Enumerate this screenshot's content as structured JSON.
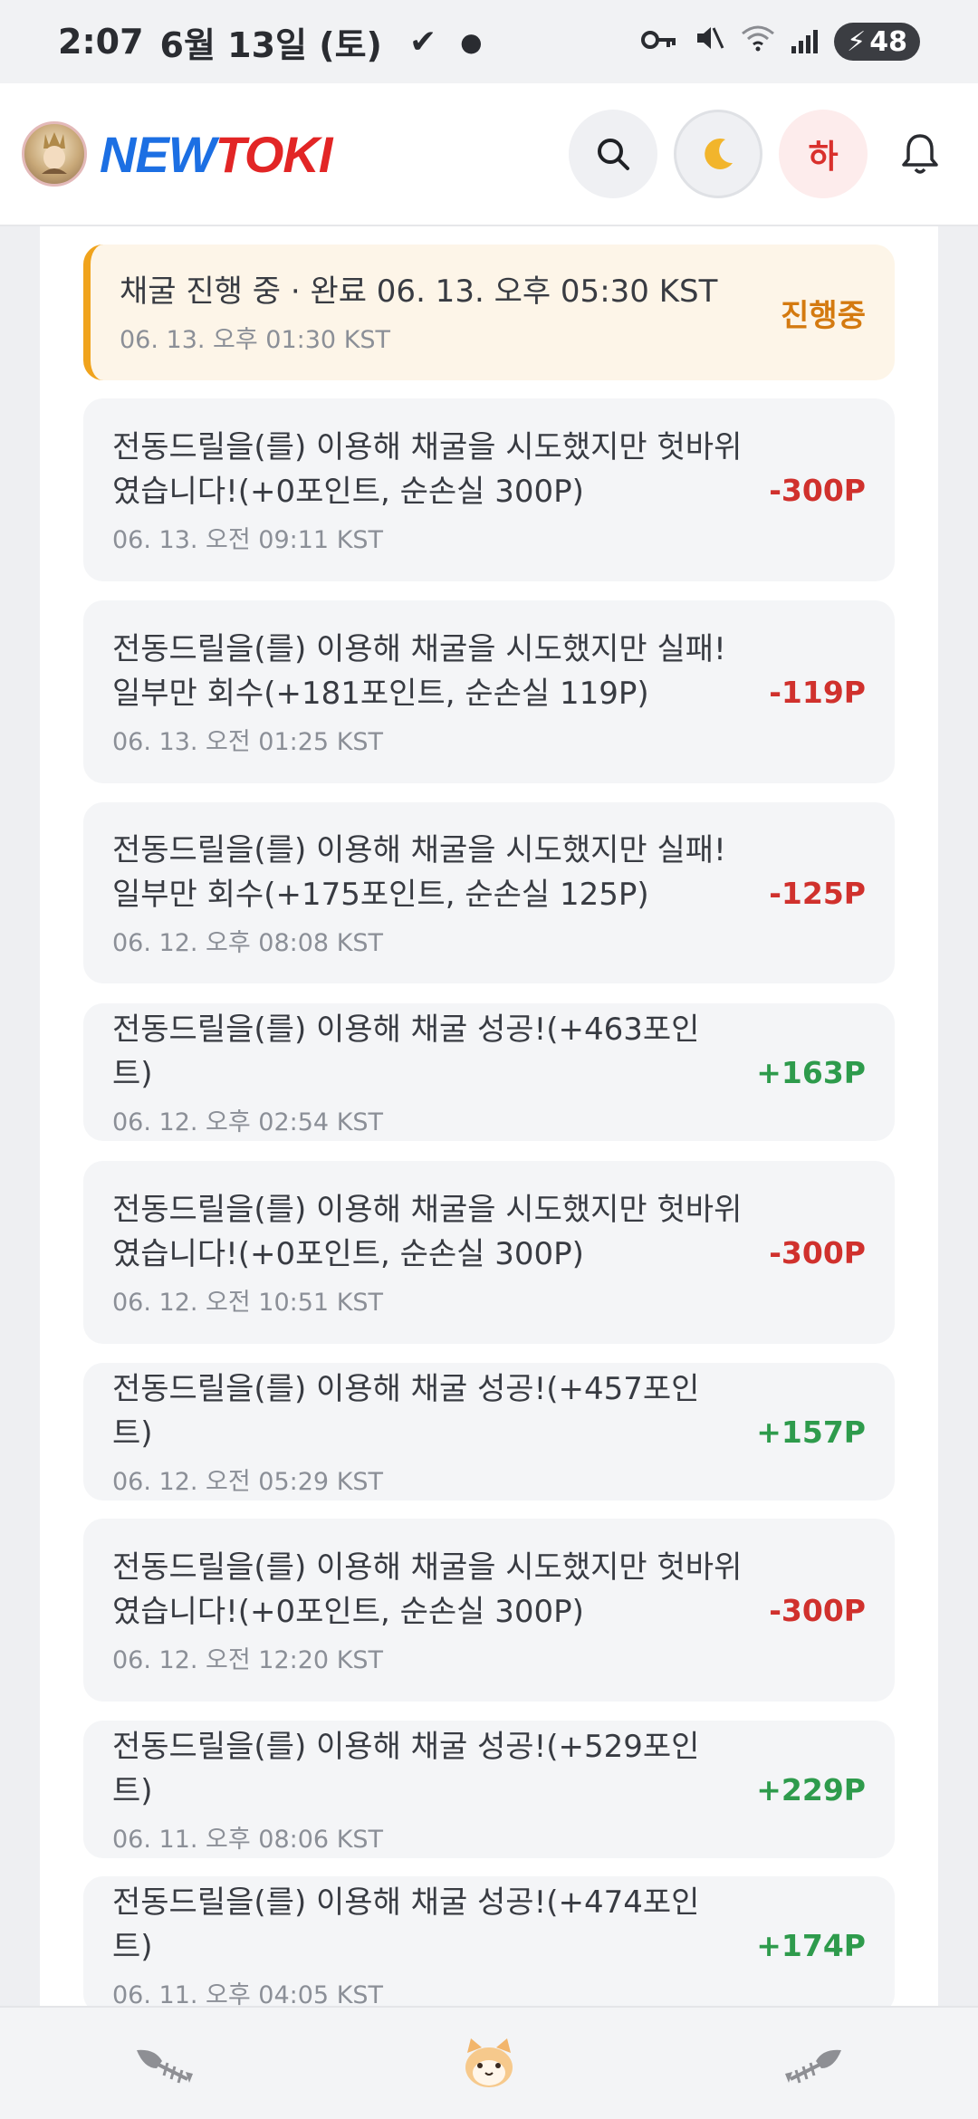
{
  "status_bar": {
    "time": "2:07",
    "date": "6월 13일 (토)",
    "battery": "48"
  },
  "header": {
    "logo_new": "NEW",
    "logo_toki": "TOKI",
    "level_label": "하"
  },
  "log": [
    {
      "desc": "채굴 진행 중 · 완료 06. 13. 오후 05:30 KST",
      "time": "06. 13. 오후 01:30 KST",
      "amount": "진행중",
      "kind": "progress"
    },
    {
      "desc": "전동드릴을(를) 이용해 채굴을 시도했지만 헛바위였습니다!(+0포인트, 순손실 300P)",
      "time": "06. 13. 오전 09:11 KST",
      "amount": "-300P",
      "kind": "neg"
    },
    {
      "desc": "전동드릴을(를) 이용해 채굴을 시도했지만 실패! 일부만 회수(+181포인트, 순손실 119P)",
      "time": "06. 13. 오전 01:25 KST",
      "amount": "-119P",
      "kind": "neg"
    },
    {
      "desc": "전동드릴을(를) 이용해 채굴을 시도했지만 실패! 일부만 회수(+175포인트, 순손실 125P)",
      "time": "06. 12. 오후 08:08 KST",
      "amount": "-125P",
      "kind": "neg"
    },
    {
      "desc": "전동드릴을(를) 이용해 채굴 성공!(+463포인트)",
      "time": "06. 12. 오후 02:54 KST",
      "amount": "+163P",
      "kind": "pos"
    },
    {
      "desc": "전동드릴을(를) 이용해 채굴을 시도했지만 헛바위였습니다!(+0포인트, 순손실 300P)",
      "time": "06. 12. 오전 10:51 KST",
      "amount": "-300P",
      "kind": "neg"
    },
    {
      "desc": "전동드릴을(를) 이용해 채굴 성공!(+457포인트)",
      "time": "06. 12. 오전 05:29 KST",
      "amount": "+157P",
      "kind": "pos"
    },
    {
      "desc": "전동드릴을(를) 이용해 채굴을 시도했지만 헛바위였습니다!(+0포인트, 순손실 300P)",
      "time": "06. 12. 오전 12:20 KST",
      "amount": "-300P",
      "kind": "neg"
    },
    {
      "desc": "전동드릴을(를) 이용해 채굴 성공!(+529포인트)",
      "time": "06. 11. 오후 08:06 KST",
      "amount": "+229P",
      "kind": "pos"
    },
    {
      "desc": "전동드릴을(를) 이용해 채굴 성공!(+474포인트)",
      "time": "06. 11. 오후 04:05 KST",
      "amount": "+174P",
      "kind": "pos"
    }
  ],
  "colors": {
    "negative": "#d0312d",
    "positive": "#2e9b4c",
    "progress": "#d47a10",
    "progress_bar": "#f0a31c"
  }
}
